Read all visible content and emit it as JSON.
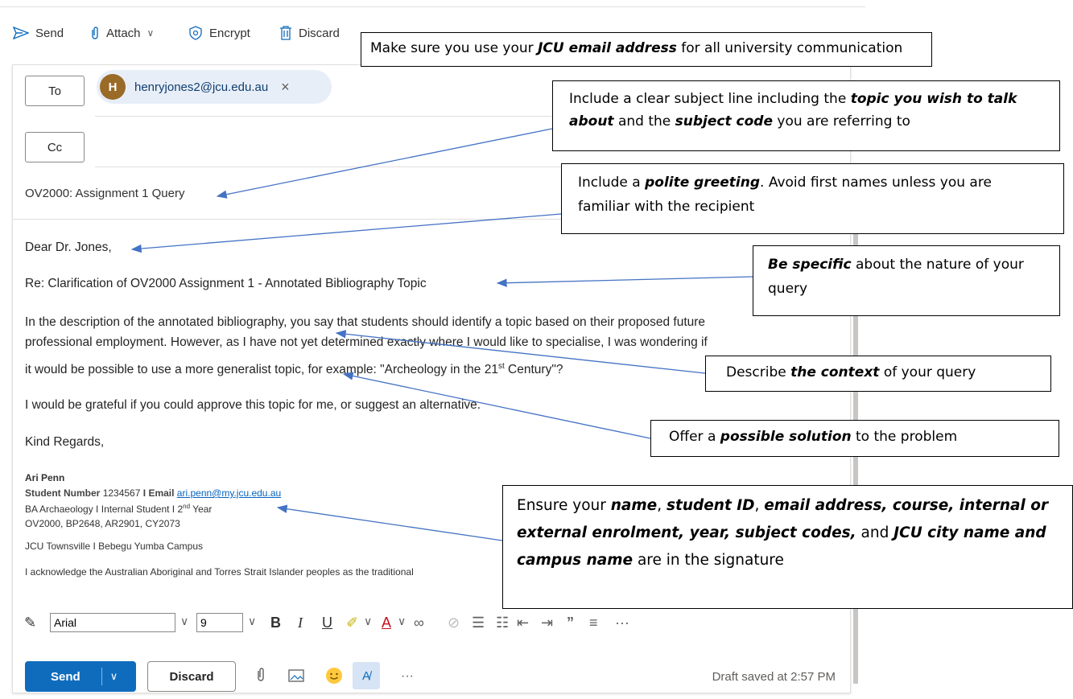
{
  "toolbar": {
    "send": "Send",
    "attach": "Attach",
    "encrypt": "Encrypt",
    "discard": "Discard"
  },
  "recipients": {
    "to_label": "To",
    "cc_label": "Cc",
    "avatar_initial": "H",
    "to_email": "henryjones2@jcu.edu.au",
    "remove_icon": "×"
  },
  "subject": "OV2000: Assignment 1 Query",
  "body": {
    "greeting": "Dear Dr. Jones,",
    "re_line": "Re: Clarification of OV2000 Assignment 1 - Annotated Bibliography Topic",
    "para1_line1": "In the description of the annotated bibliography, you say that students should identify a topic based on their proposed future",
    "para1_line2": "professional employment. However, as I have not yet determined exactly where I would like to specialise, I was wondering if",
    "para1_line3_pre": "it would be possible to use a more generalist topic, for example: \"Archeology in the 21",
    "para1_line3_sup": "st",
    "para1_line3_post": " Century\"?",
    "para2": "I would be grateful if you could approve this topic for me, or suggest an alternative.",
    "closing": "Kind Regards,"
  },
  "signature": {
    "name": "Ari Penn",
    "student_number_label": "Student Number",
    "student_number": "1234567",
    "sep1": "I",
    "email_label": "Email",
    "email": "ari.penn@my.jcu.edu.au",
    "course_pre": "BA Archaeology I Internal Student   I 2",
    "course_sup": "nd",
    "course_post": " Year",
    "subjects": "OV2000, BP2648, AR2901, CY2073",
    "campus": "JCU Townsville   I   Bebegu Yumba Campus",
    "acknowledgement": "I acknowledge the Australian Aboriginal and Torres Strait Islander peoples as the traditional"
  },
  "format_bar": {
    "font": "Arial",
    "size": "9",
    "bold": "B",
    "italic": "I",
    "underline": "U",
    "more": "···"
  },
  "bottom": {
    "send": "Send",
    "discard": "Discard",
    "more": "···",
    "draft_status": "Draft saved at 2:57 PM"
  },
  "callouts": {
    "c1": {
      "pre": "Make sure you use your ",
      "em": "JCU email address",
      "post": " for all university communication"
    },
    "c2": {
      "pre": "Include a clear subject line including the ",
      "em1": "topic you wish to talk about",
      "mid": " and the ",
      "em2": "subject code",
      "post": " you are referring to"
    },
    "c3": {
      "pre": "Include a ",
      "em": "polite greeting",
      "post": ". Avoid first names unless you are familiar with the recipient"
    },
    "c4": {
      "em": "Be specific",
      "post": " about the nature of your query"
    },
    "c5": {
      "pre": "Describe ",
      "em": "the context",
      "post": " of your query"
    },
    "c6": {
      "pre": "Offer a ",
      "em": "possible solution",
      "post": " to the problem"
    },
    "c7": {
      "pre": "Ensure your ",
      "em1": "name",
      "sep1": ", ",
      "em2": "student ID",
      "sep2": ", ",
      "em3": "email address, course, internal or external enrolment, year, subject codes,",
      "mid": " and ",
      "em4": "JCU city name and campus name",
      "post": " are in the signature"
    }
  },
  "colors": {
    "accent": "#0f6cbd",
    "arrow": "#4472c4",
    "avatar": "#9a6a27",
    "pill": "#e8eef8"
  }
}
